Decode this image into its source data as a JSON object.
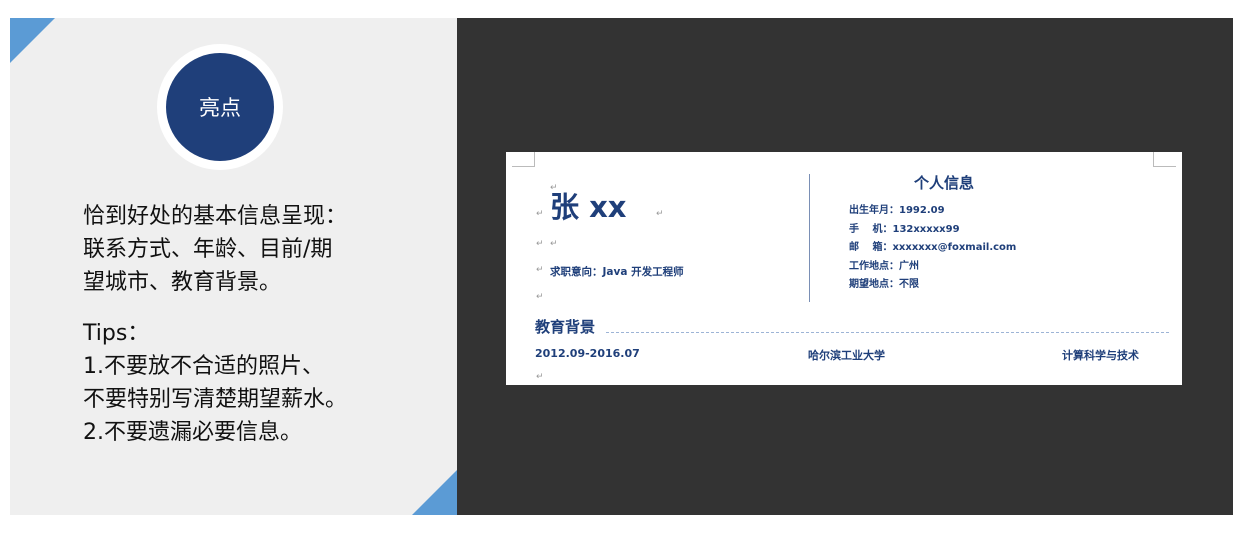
{
  "badge": {
    "label": "亮点"
  },
  "left_text": {
    "lines": [
      "恰到好处的基本信息呈现：",
      "联系方式、年龄、目前/期",
      "望城市、教育背景。"
    ],
    "tips_title": "Tips：",
    "tips": [
      "1.不要放不合适的照片、",
      "不要特别写清楚期望薪水。",
      "2.不要遗漏必要信息。"
    ]
  },
  "resume": {
    "name": "张 xx",
    "job_intention": "求职意向：Java 开发工程师",
    "info_title": "个人信息",
    "info_rows": [
      "出生年月：1992.09",
      "手　 机：132xxxxx99",
      "邮　 箱：xxxxxxx@foxmail.com",
      "工作地点：广州",
      "期望地点：不限"
    ],
    "education_title": "教育背景",
    "education": {
      "period": "2012.09-2016.07",
      "school": "哈尔滨工业大学",
      "major": "计算科学与技术"
    },
    "paragraph_mark": "↵"
  },
  "colors": {
    "accent_blue": "#1f3f7a",
    "triangle_blue": "#5b9bd5",
    "panel_gray": "#efefef",
    "dark_panel": "#333333"
  }
}
